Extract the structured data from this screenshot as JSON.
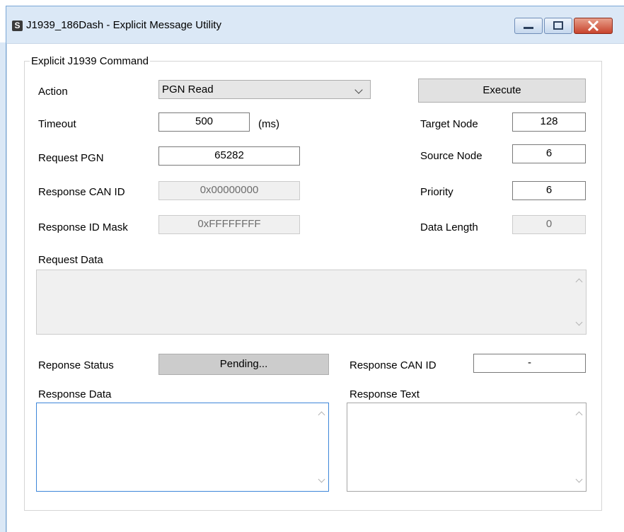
{
  "window": {
    "title": "J1939_186Dash - Explicit Message Utility",
    "app_icon_glyph": "S"
  },
  "group": {
    "legend": "Explicit J1939 Command"
  },
  "fields": {
    "action_label": "Action",
    "action_value": "PGN Read",
    "execute_label": "Execute",
    "timeout_label": "Timeout",
    "timeout_value": "500",
    "timeout_unit": "(ms)",
    "target_node_label": "Target Node",
    "target_node_value": "128",
    "request_pgn_label": "Request PGN",
    "request_pgn_value": "65282",
    "source_node_label": "Source Node",
    "source_node_value": "6",
    "response_can_id_label": "Response CAN ID",
    "response_can_id_value": "0x00000000",
    "priority_label": "Priority",
    "priority_value": "6",
    "response_id_mask_label": "Response ID Mask",
    "response_id_mask_value": "0xFFFFFFFF",
    "data_length_label": "Data Length",
    "data_length_value": "0",
    "request_data_label": "Request Data",
    "response_status_label": "Reponse Status",
    "response_status_value": "Pending...",
    "response_can_id2_label": "Response CAN ID",
    "response_can_id2_value": "-",
    "response_data_label": "Response Data",
    "response_text_label": "Response Text"
  }
}
